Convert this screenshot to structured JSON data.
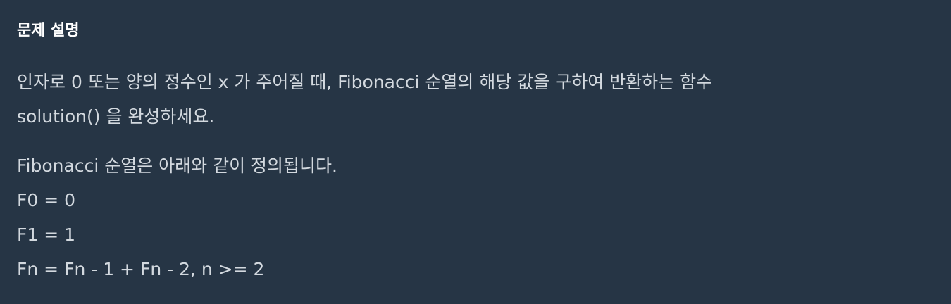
{
  "problem": {
    "title": "문제 설명",
    "description_lines": [
      "인자로 0 또는 양의 정수인 x 가 주어질 때, Fibonacci 순열의 해당 값을 구하여 반환하는 함수",
      "solution() 을 완성하세요."
    ],
    "definition_lines": [
      "Fibonacci 순열은 아래와 같이 정의됩니다.",
      "F0 = 0",
      "F1 = 1",
      "Fn = Fn - 1 + Fn - 2, n >= 2"
    ]
  }
}
